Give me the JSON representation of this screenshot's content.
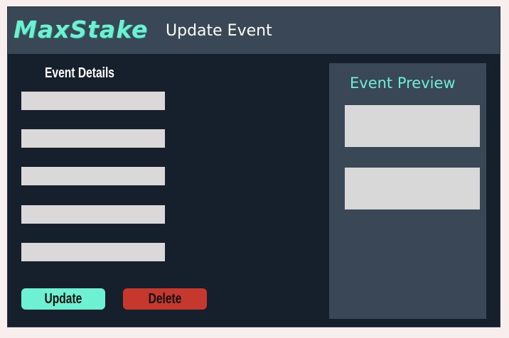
{
  "header": {
    "brand": "MaxStake",
    "title": "Update Event"
  },
  "event_details": {
    "heading": "Event Details",
    "fields": [
      {
        "value": "",
        "placeholder": ""
      },
      {
        "value": "",
        "placeholder": ""
      },
      {
        "value": "",
        "placeholder": ""
      },
      {
        "value": "",
        "placeholder": ""
      },
      {
        "value": "",
        "placeholder": ""
      }
    ],
    "update_label": "Update",
    "delete_label": "Delete"
  },
  "preview": {
    "heading": "Event Preview"
  },
  "colors": {
    "accent": "#6ef0d2",
    "danger": "#c6382d",
    "background": "#15202c",
    "panel": "#3a4757"
  }
}
